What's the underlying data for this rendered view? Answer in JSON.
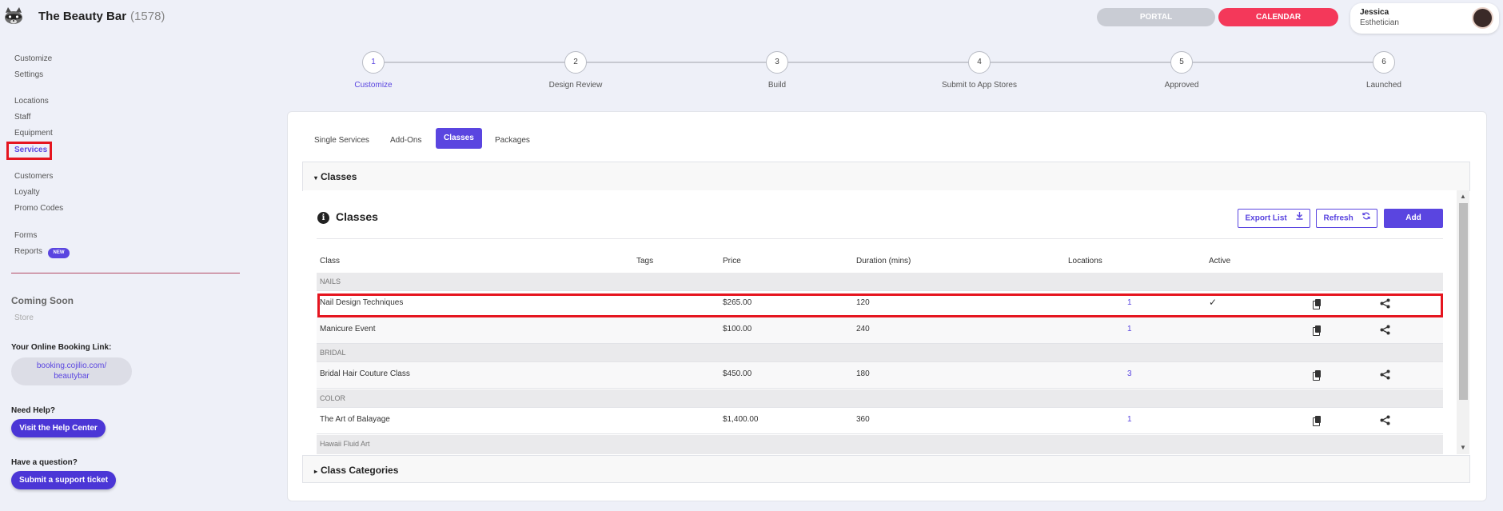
{
  "header": {
    "brand": "The Beauty Bar",
    "count": "(1578)",
    "portal_label": "PORTAL",
    "calendar_label": "CALENDAR",
    "user_name": "Jessica",
    "user_role": "Esthetician"
  },
  "sidebar": {
    "groups": [
      [
        "Customize",
        "Settings"
      ],
      [
        "Locations",
        "Staff",
        "Equipment",
        "Services"
      ],
      [
        "Customers",
        "Loyalty",
        "Promo Codes"
      ],
      [
        "Forms",
        "Reports"
      ]
    ],
    "items": {
      "customize": "Customize",
      "settings": "Settings",
      "locations": "Locations",
      "staff": "Staff",
      "equipment": "Equipment",
      "services": "Services",
      "customers": "Customers",
      "loyalty": "Loyalty",
      "promo_codes": "Promo Codes",
      "forms": "Forms",
      "reports": "Reports"
    },
    "new_badge": "NEW",
    "coming_soon": "Coming Soon",
    "store": "Store",
    "booking_heading": "Your Online Booking Link:",
    "booking_link_line1": "booking.cojilio.com/",
    "booking_link_line2": "beautybar",
    "help_heading": "Need Help?",
    "help_button": "Visit the Help Center",
    "question_heading": "Have a question?",
    "ticket_button": "Submit a support ticket"
  },
  "stepper": {
    "steps": [
      {
        "num": "1",
        "label": "Customize"
      },
      {
        "num": "2",
        "label": "Design Review"
      },
      {
        "num": "3",
        "label": "Build"
      },
      {
        "num": "4",
        "label": "Submit to App Stores"
      },
      {
        "num": "5",
        "label": "Approved"
      },
      {
        "num": "6",
        "label": "Launched"
      }
    ],
    "active_index": 0
  },
  "tabs": [
    "Single Services",
    "Add-Ons",
    "Classes",
    "Packages"
  ],
  "active_tab": "Classes",
  "sections": {
    "classes_title": "Classes",
    "categories_title": "Class Categories"
  },
  "panel": {
    "title": "Classes",
    "export_label": "Export List",
    "refresh_label": "Refresh",
    "add_label": "Add"
  },
  "table": {
    "columns": [
      "Class",
      "Tags",
      "Price",
      "Duration (mins)",
      "Locations",
      "Active"
    ],
    "groups": [
      {
        "name": "NAILS",
        "rows": [
          {
            "class": "Nail Design Techniques",
            "tags": "",
            "price": "$265.00",
            "duration": "120",
            "locations": "1",
            "active": "✓"
          },
          {
            "class": "Manicure Event",
            "tags": "",
            "price": "$100.00",
            "duration": "240",
            "locations": "1",
            "active": ""
          }
        ]
      },
      {
        "name": "BRIDAL",
        "rows": [
          {
            "class": "Bridal Hair Couture Class",
            "tags": "",
            "price": "$450.00",
            "duration": "180",
            "locations": "3",
            "active": ""
          }
        ]
      },
      {
        "name": "COLOR",
        "rows": [
          {
            "class": "The Art of Balayage",
            "tags": "",
            "price": "$1,400.00",
            "duration": "360",
            "locations": "1",
            "active": ""
          }
        ]
      },
      {
        "name": "Hawaii Fluid Art",
        "rows": []
      }
    ]
  },
  "icons": {
    "logo": "raccoon-logo-icon",
    "info": "info-icon",
    "export": "download-icon",
    "refresh": "refresh-icon",
    "copy": "copy-icon",
    "share": "share-icon"
  },
  "colors": {
    "accent": "#5a45e0",
    "calendar": "#f4385a",
    "highlight": "#e5151f"
  }
}
